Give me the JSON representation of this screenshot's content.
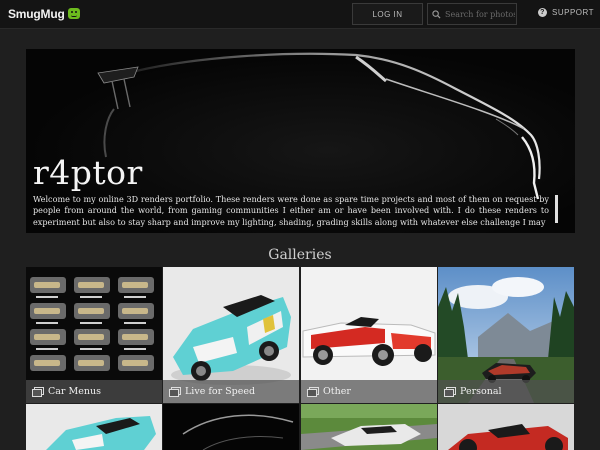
{
  "header": {
    "logo_text": "SmugMug",
    "login_label": "LOG IN",
    "search_placeholder": "Search for photos",
    "support_label": "SUPPORT",
    "brand_color": "#6dbb1e"
  },
  "hero": {
    "title": "r4ptor",
    "description": "Welcome to my online 3D renders portfolio. These renders were done as spare time projects and most of them on request by people from around the world, from gaming communities I either am or have been involved with. I do these renders to experiment but also to stay sharp and improve my lighting, shading, grading skills along with whatever else challenge I may"
  },
  "galleries": {
    "heading": "Galleries",
    "items": [
      {
        "label": "Car Menus",
        "icon": "gallery-icon"
      },
      {
        "label": "Live for Speed",
        "icon": "gallery-icon"
      },
      {
        "label": "Other",
        "icon": "gallery-icon"
      },
      {
        "label": "Personal",
        "icon": "gallery-icon"
      },
      {
        "label": "",
        "icon": ""
      },
      {
        "label": "",
        "icon": ""
      },
      {
        "label": "",
        "icon": ""
      },
      {
        "label": "",
        "icon": ""
      }
    ]
  }
}
